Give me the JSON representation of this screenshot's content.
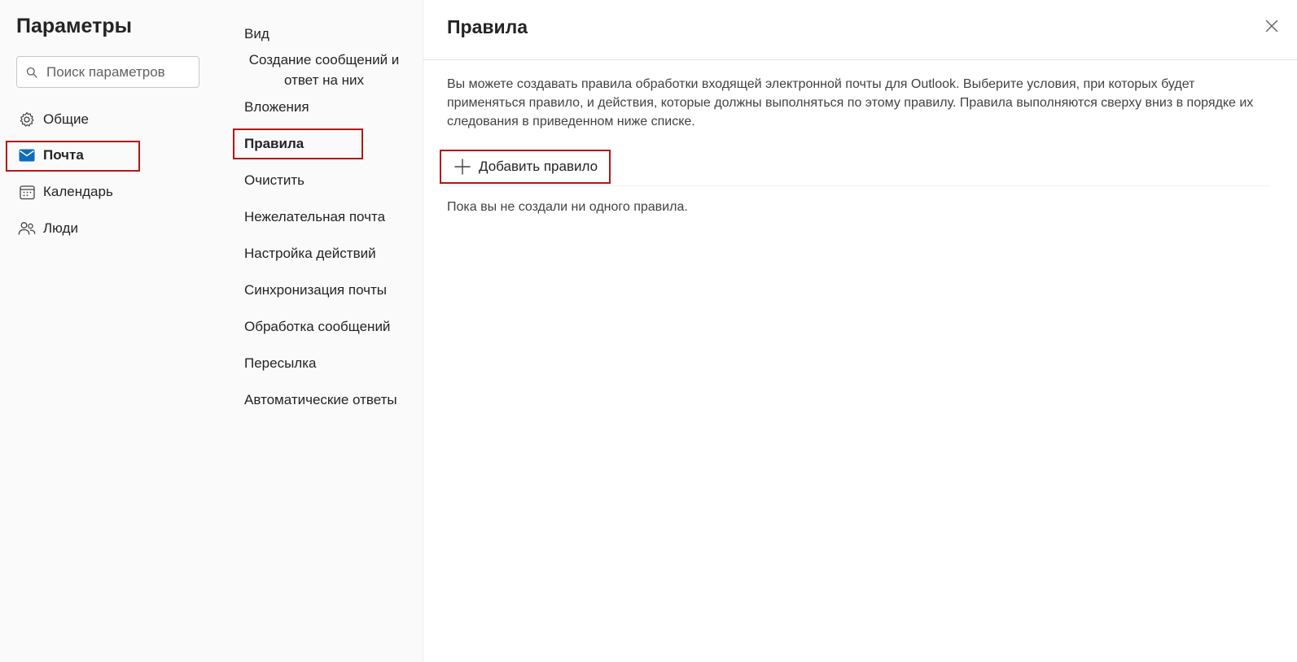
{
  "settings": {
    "title": "Параметры",
    "search_placeholder": "Поиск параметров"
  },
  "categories": [
    {
      "label": "Общие",
      "icon": "gear-icon"
    },
    {
      "label": "Почта",
      "icon": "mail-icon",
      "selected": true
    },
    {
      "label": "Календарь",
      "icon": "calendar-icon"
    },
    {
      "label": "Люди",
      "icon": "people-icon"
    }
  ],
  "mail_sections": [
    {
      "label": "Вид"
    },
    {
      "label": "Создание сообщений и ответ на них"
    },
    {
      "label": "Вложения"
    },
    {
      "label": "Правила",
      "selected": true
    },
    {
      "label": "Очистить"
    },
    {
      "label": "Нежелательная почта"
    },
    {
      "label": "Настройка действий"
    },
    {
      "label": "Синхронизация почты"
    },
    {
      "label": "Обработка сообщений"
    },
    {
      "label": "Пересылка"
    },
    {
      "label": "Автоматические ответы"
    }
  ],
  "panel": {
    "title": "Правила",
    "description": "Вы можете создавать правила обработки входящей электронной почты для Outlook. Выберите условия, при которых будет применяться правило, и действия, которые должны выполняться по этому правилу. Правила выполняются сверху вниз в порядке их следования в приведенном ниже списке.",
    "add_rule_label": "Добавить правило",
    "empty_text": "Пока вы не создали ни одного правила."
  },
  "colors": {
    "accent": "#0f6cbd",
    "highlight": "#b41616"
  }
}
